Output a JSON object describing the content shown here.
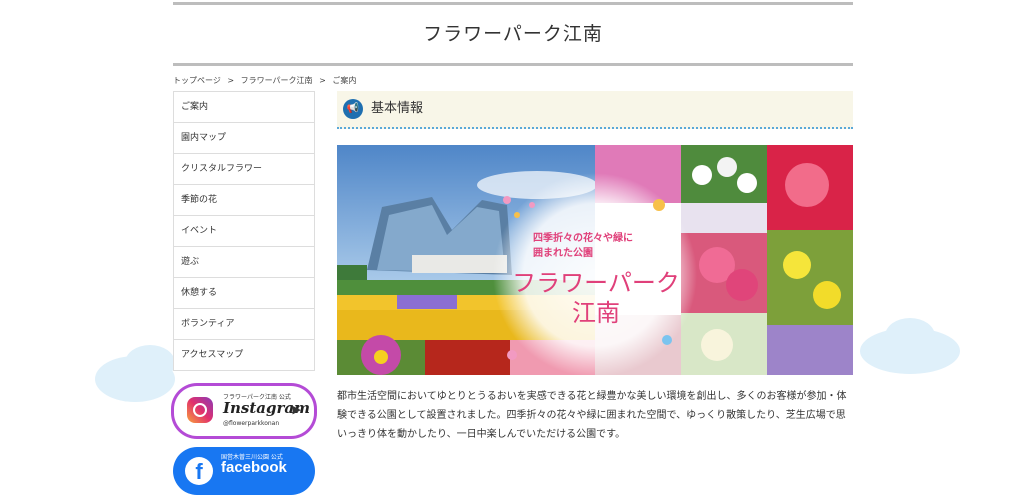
{
  "site": {
    "title": "フラワーパーク江南"
  },
  "breadcrumb": {
    "items": [
      "トップページ",
      "フラワーパーク江南",
      "ご案内"
    ],
    "separator": ">"
  },
  "sidebar": {
    "items": [
      {
        "label": "ご案内"
      },
      {
        "label": "園内マップ"
      },
      {
        "label": "クリスタルフラワー"
      },
      {
        "label": "季節の花"
      },
      {
        "label": "イベント"
      },
      {
        "label": "遊ぶ"
      },
      {
        "label": "休憩する"
      },
      {
        "label": "ボランティア"
      },
      {
        "label": "アクセスマップ"
      }
    ],
    "instagram": {
      "caption": "フラワーパーク江南 公式",
      "brand": "Instagram",
      "handle": "@flowerparkkonan"
    },
    "facebook": {
      "caption": "国営木曽三川公園 公式",
      "brand": "facebook"
    }
  },
  "main": {
    "section_title": "基本情報",
    "hero": {
      "tagline_line1": "四季折々の花々や緑に",
      "tagline_line2": "囲まれた公園",
      "name_line1": "フラワーパーク",
      "name_line2": "江南"
    },
    "description": "都市生活空間においてゆとりとうるおいを実感できる花と緑豊かな美しい環境を創出し、多くのお客様が参加・体験できる公園として設置されました。四季折々の花々や緑に囲まれた空間で、ゆっくり散策したり、芝生広場で思いっきり体を動かしたり、一日中楽しんでいただける公園です。"
  },
  "colors": {
    "accent": "#1e6fb0",
    "section_bg": "#f8f6e8",
    "dotted": "#5aa8d8",
    "hero_title": "#e0407a",
    "facebook": "#1877f2"
  }
}
